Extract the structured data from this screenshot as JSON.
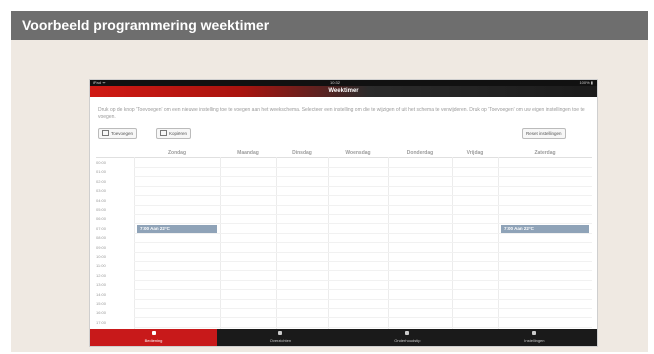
{
  "frame": {
    "title": "Voorbeeld programmering weektimer"
  },
  "statusbar": {
    "carrier": "iPad ᯤ",
    "time": "10:32",
    "battery": "100% ▮"
  },
  "navbar": {
    "title": "Weektimer"
  },
  "instructions": "Druk op de knop 'Toevoegen' om een nieuwe instelling toe te voegen aan het weekschema. Selecteer een instelling om die te wijzigen of uit het schema te verwijderen. Druk op 'Toevoegen' om uw eigen instellingen toe te voegen.",
  "toolbar": {
    "add_label": "Toevoegen",
    "copy_label": "Kopiëren",
    "reset_label": "Reset instellingen"
  },
  "days": [
    "Zondag",
    "Maandag",
    "Dinsdag",
    "Woensdag",
    "Donderdag",
    "Vrijdag",
    "Zaterdag"
  ],
  "hours": [
    "00:00",
    "01:00",
    "02:00",
    "03:00",
    "04:00",
    "05:00",
    "06:00",
    "07:00",
    "08:00",
    "09:00",
    "10:00",
    "11:00",
    "12:00",
    "13:00",
    "14:00",
    "15:00",
    "16:00",
    "17:00"
  ],
  "blocks": [
    {
      "day": "Zondag",
      "label": "7:00 Aan 22°C"
    },
    {
      "day": "Zaterdag",
      "label": "7:00 Aan 22°C"
    }
  ],
  "tabs": [
    {
      "label": "Bediening",
      "icon": "flame-icon",
      "active": true
    },
    {
      "label": "Overzichten",
      "icon": "chart-icon",
      "active": false
    },
    {
      "label": "Onderhoudstip",
      "icon": "info-icon",
      "active": false
    },
    {
      "label": "Instellingen",
      "icon": "gear-icon",
      "active": false
    }
  ],
  "colors": {
    "accent": "#c8191a",
    "block": "#8fa3b8",
    "header": "#6e6e6e"
  }
}
